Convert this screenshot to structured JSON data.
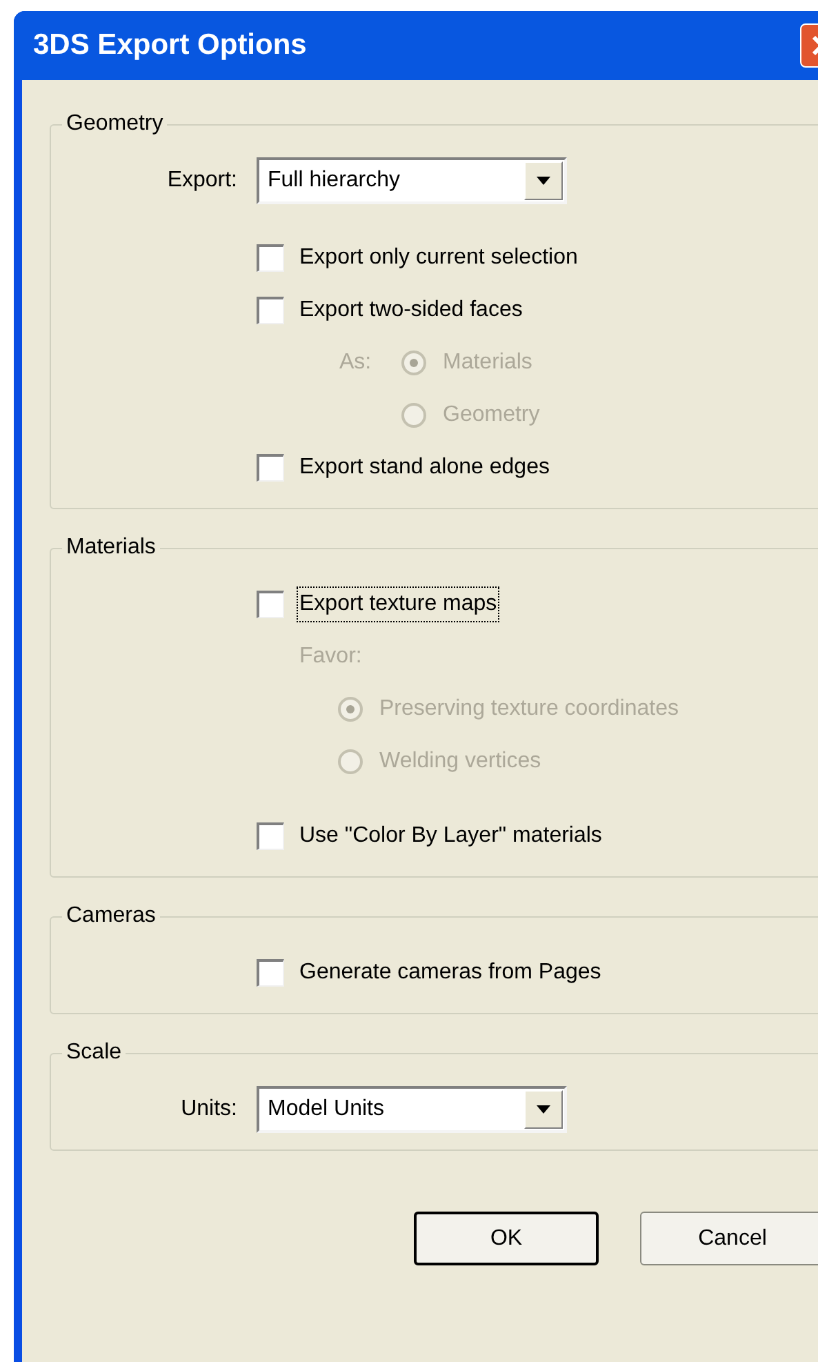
{
  "window": {
    "title": "3DS Export Options"
  },
  "groups": [
    {
      "title": "Geometry",
      "items": [
        {
          "kind": "select",
          "label": "Export:",
          "value": "Full hierarchy"
        },
        {
          "kind": "checkbox",
          "label": "Export only current selection",
          "checked": false,
          "focused": false
        },
        {
          "kind": "checkbox",
          "label": "Export two-sided faces",
          "checked": false,
          "focused": false
        },
        {
          "kind": "radio_inline",
          "label": "As:",
          "disabled": true,
          "options": [
            {
              "label": "Materials",
              "selected": true
            },
            {
              "label": "Geometry",
              "selected": false
            }
          ]
        },
        {
          "kind": "checkbox",
          "label": "Export stand alone edges",
          "checked": false,
          "focused": false
        }
      ]
    },
    {
      "title": "Materials",
      "items": [
        {
          "kind": "checkbox",
          "label": "Export texture maps",
          "checked": false,
          "focused": true
        },
        {
          "kind": "radio_list",
          "label": "Favor:",
          "disabled": true,
          "options": [
            {
              "label": "Preserving texture coordinates",
              "selected": true
            },
            {
              "label": "Welding vertices",
              "selected": false
            }
          ]
        },
        {
          "kind": "checkbox",
          "label": "Use \"Color By Layer\" materials",
          "checked": false,
          "focused": false
        }
      ]
    },
    {
      "title": "Cameras",
      "items": [
        {
          "kind": "checkbox",
          "label": "Generate cameras from Pages",
          "checked": false,
          "focused": false
        }
      ]
    },
    {
      "title": "Scale",
      "items": [
        {
          "kind": "select",
          "label": "Units:",
          "value": "Model Units"
        }
      ]
    }
  ],
  "buttons": [
    {
      "label": "OK",
      "default": true
    },
    {
      "label": "Cancel",
      "default": false
    }
  ]
}
